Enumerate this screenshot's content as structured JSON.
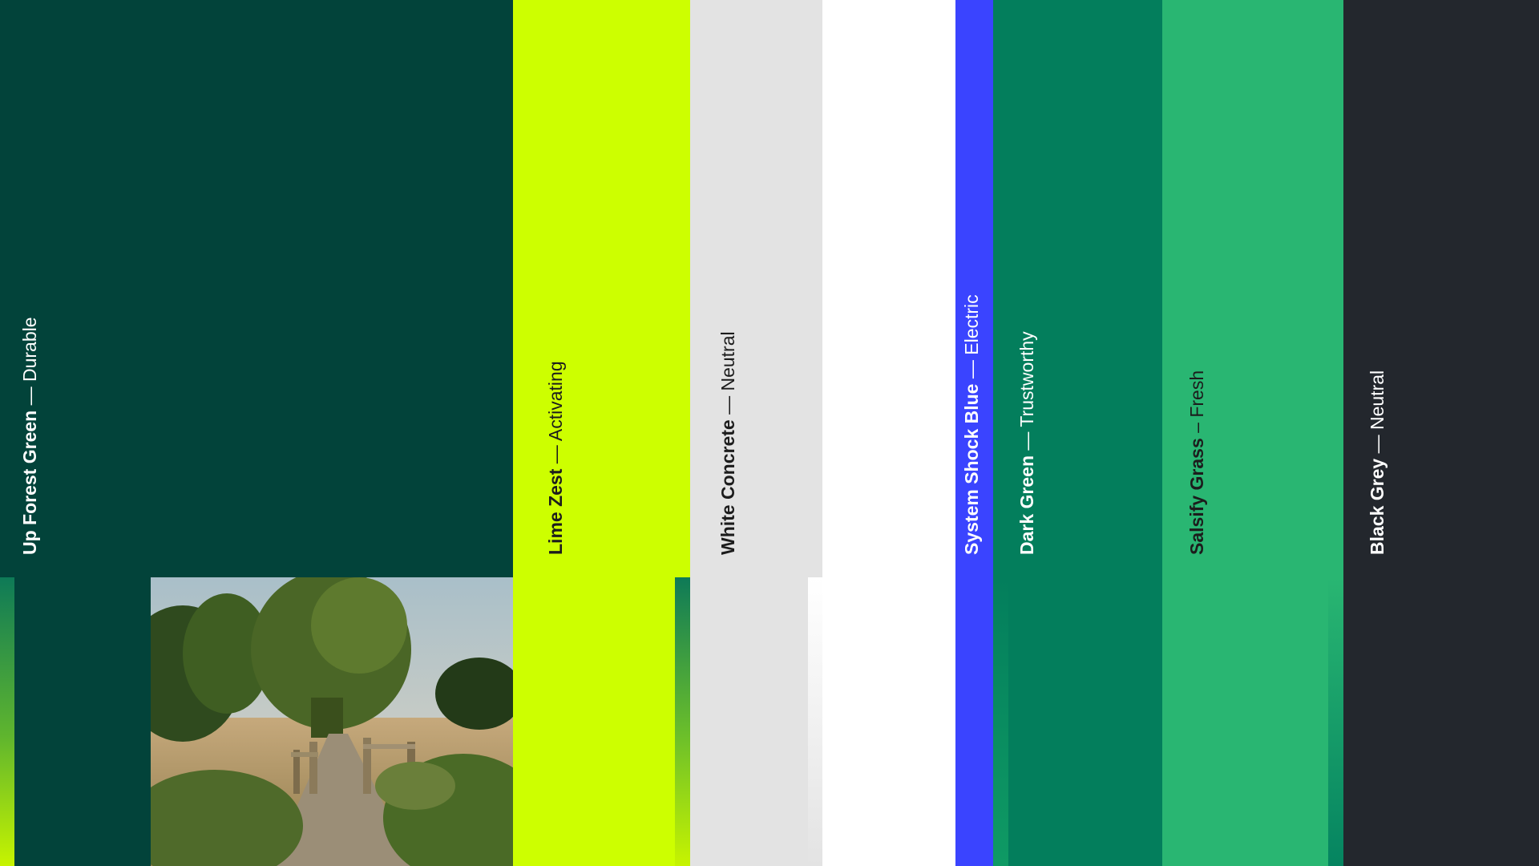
{
  "swatches": [
    {
      "name": "Up Forest Green",
      "sep": " — ",
      "desc": "Durable",
      "color": "#02433a"
    },
    {
      "name": "Lime Zest",
      "sep": " — ",
      "desc": "Activating",
      "color": "#cdff00"
    },
    {
      "name": "White Concrete",
      "sep": " — ",
      "desc": "Neutral",
      "color": "#e3e3e3"
    },
    {
      "name": "System Shock Blue",
      "sep": " — ",
      "desc": "Electric",
      "color": "#3a44ff"
    },
    {
      "name": "Dark Green",
      "sep": " — ",
      "desc": "Trustworthy",
      "color": "#037e5c"
    },
    {
      "name": "Salsify Grass",
      "sep": " – ",
      "desc": "Fresh",
      "color": "#29b672"
    },
    {
      "name": "Black Grey",
      "sep": " — ",
      "desc": "Neutral",
      "color": "#23272d"
    }
  ],
  "photo": {
    "subject": "landscape-photo-footbridge-meadow-willow"
  }
}
